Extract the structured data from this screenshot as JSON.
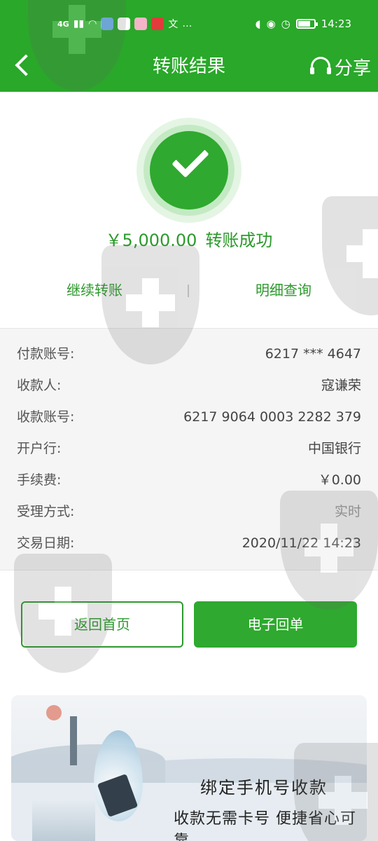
{
  "status_bar": {
    "signal": "4G",
    "time": "14:23",
    "more": "…",
    "translate_glyph": "文"
  },
  "header": {
    "title": "转账结果",
    "share_label": "分享"
  },
  "result": {
    "amount": "￥5,000.00",
    "status": "转账成功"
  },
  "actions": {
    "continue_label": "继续转账",
    "detail_label": "明细查询"
  },
  "details": [
    {
      "label": "付款账号:",
      "value": "6217 *** 4647"
    },
    {
      "label": "收款人:",
      "value": "寇谦荣"
    },
    {
      "label": "收款账号:",
      "value": "6217 9064 0003 2282 379"
    },
    {
      "label": "开户行:",
      "value": "中国银行"
    },
    {
      "label": "手续费:",
      "value": "￥0.00"
    },
    {
      "label": "受理方式:",
      "value": "实时"
    },
    {
      "label": "交易日期:",
      "value": "2020/11/22 14:23"
    }
  ],
  "buttons": {
    "home_label": "返回首页",
    "receipt_label": "电子回单"
  },
  "banner": {
    "line1": "绑定手机号收款",
    "line2": "收款无需卡号 便捷省心可靠"
  },
  "colors": {
    "primary": "#29a829",
    "primary_text": "#2c9a2c",
    "detail_bg": "#f5f5f5"
  }
}
